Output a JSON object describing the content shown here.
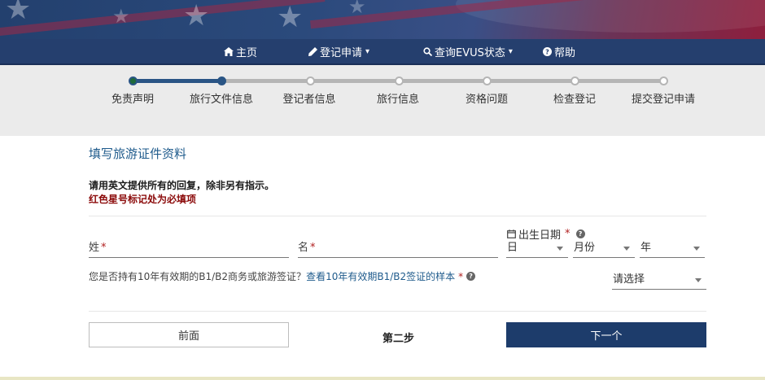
{
  "nav": {
    "home": "主页",
    "register": "登记申请",
    "check_status": "查询EVUS状态",
    "help": "帮助"
  },
  "progress": {
    "steps": [
      "免责声明",
      "旅行文件信息",
      "登记者信息",
      "旅行信息",
      "资格问题",
      "检查登记",
      "提交登记申请"
    ],
    "current_step_index": 1
  },
  "form": {
    "section_title": "填写旅游证件资料",
    "instruction_english": "请用英文提供所有的回复，除非另有指示。",
    "instruction_required": "红色星号标记处为必填项",
    "surname_label": "姓",
    "given_name_label": "名",
    "required_marker": "*",
    "dob_label": "出生日期",
    "dob_day": "日",
    "dob_month": "月份",
    "dob_year": "年",
    "visa_question": "您是否持有10年有效期的B1/B2商务或旅游签证？",
    "visa_sample_link": "查看10年有效期B1/B2签证的样本",
    "visa_select_value": "请选择"
  },
  "footer": {
    "prev_button": "前面",
    "step_indicator": "第二步",
    "next_button": "下一个"
  },
  "colors": {
    "nav_bg": "#253f6e",
    "primary_button": "#1d3c6b",
    "progress_done": "#2a5585",
    "required_text": "#8b0a0a",
    "link": "#1f5b8c"
  }
}
